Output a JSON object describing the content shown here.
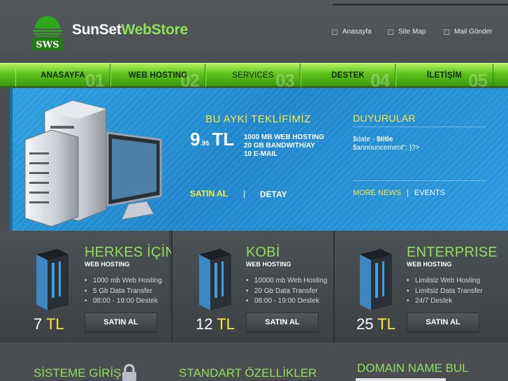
{
  "header": {
    "logo_badge": "SWS",
    "logo_main": "SunSet",
    "logo_accent": "WebStore",
    "links": [
      {
        "label": "Anasayfa"
      },
      {
        "label": "Site Map"
      },
      {
        "label": "Mail Gönder"
      }
    ]
  },
  "nav": {
    "items": [
      {
        "label": "ANASAYFA",
        "num": "01"
      },
      {
        "label": "WEB HOSTING",
        "num": "02"
      },
      {
        "label": "SERVICES",
        "num": "03"
      },
      {
        "label": "DESTEK",
        "num": "04"
      },
      {
        "label": "İLETİŞİM",
        "num": "05"
      }
    ]
  },
  "banner": {
    "offer_title": "BU AYKİ TEKLİFİMİZ",
    "price_int": "9",
    "price_dec": ".95",
    "price_unit": "TL",
    "features": [
      "1000 MB WEB HOSTING",
      "20 GB BANDWITH/AY",
      "10 E-MAIL"
    ],
    "buy_label": "SATIN AL",
    "separator": "|",
    "detail_label": "DETAY",
    "news_title": "DUYURULAR",
    "news_date": "$date - ",
    "news_bold": "$title",
    "news_body": "$announcement\"; }?>",
    "more_news": "MORE NEWS",
    "news_sep": "|",
    "events": "EVENTS"
  },
  "packages": [
    {
      "name": "HERKES İÇİN",
      "sub": "WEB HOSTING",
      "features": [
        "1000 mb Web Hosting",
        "5 Gb Data Transfer",
        "08:00 - 19:00 Destek"
      ],
      "price": "7",
      "unit": "TL",
      "buy": "SATIN AL"
    },
    {
      "name": "KOBİ",
      "sub": "WEB HOSTING",
      "features": [
        "10000 mb Web Hosting",
        "20 Gb Data Transfer",
        "08:00 - 19:00 Destek"
      ],
      "price": "12",
      "unit": "TL",
      "buy": "SATIN AL"
    },
    {
      "name": "ENTERPRISE",
      "sub": "WEB HOSTING",
      "features": [
        "Limitsiz Web Hosting",
        "Limitsiz Data Transfer",
        "24/7 Destek"
      ],
      "price": "25",
      "unit": "TL",
      "buy": "SATIN AL"
    }
  ],
  "bottom": {
    "login_title": "SİSTEME GİRİŞ",
    "features_title": "STANDART ÖZELLİKLER",
    "domain_title": "DOMAIN NAME BUL"
  },
  "colors": {
    "accent_green": "#8fe05a",
    "accent_yellow": "#ffe93a",
    "banner_blue": "#2491d6"
  }
}
